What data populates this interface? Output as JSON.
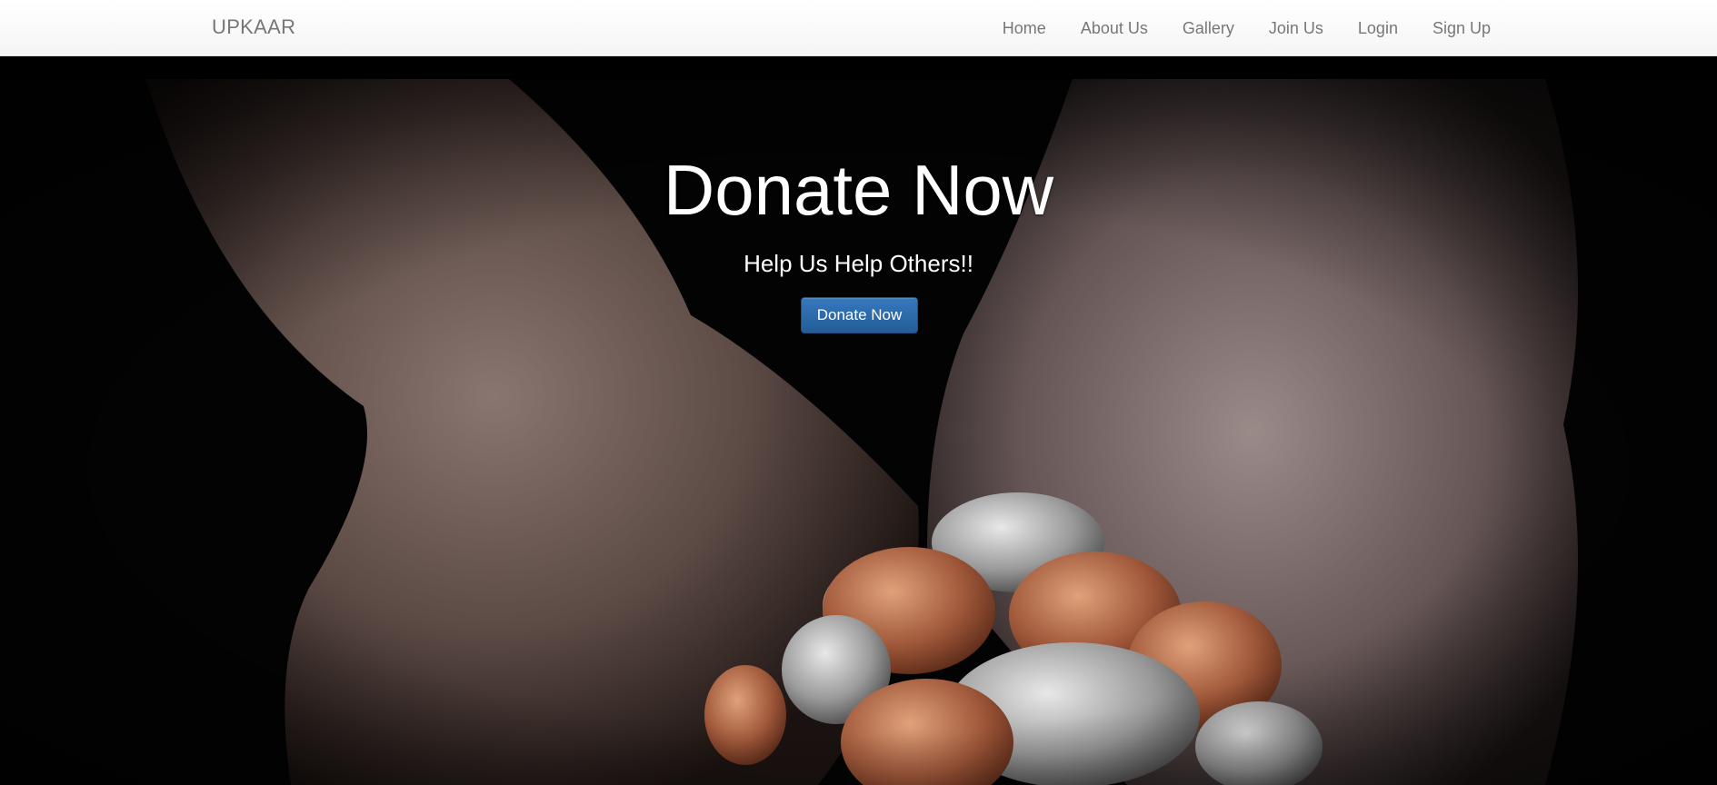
{
  "navbar": {
    "brand": "UPKAAR",
    "links": [
      {
        "label": "Home"
      },
      {
        "label": "About Us"
      },
      {
        "label": "Gallery"
      },
      {
        "label": "Join Us"
      },
      {
        "label": "Login"
      },
      {
        "label": "Sign Up"
      }
    ]
  },
  "hero": {
    "title": "Donate Now",
    "subtitle": "Help Us Help Others!!",
    "button_label": "Donate Now",
    "image_subject": "hands-holding-coins"
  },
  "colors": {
    "navbar_bg": "#f8f8f8",
    "nav_text": "#777777",
    "button_bg": "#2c6aac",
    "hero_text": "#ffffff",
    "hero_bg": "#000000"
  }
}
